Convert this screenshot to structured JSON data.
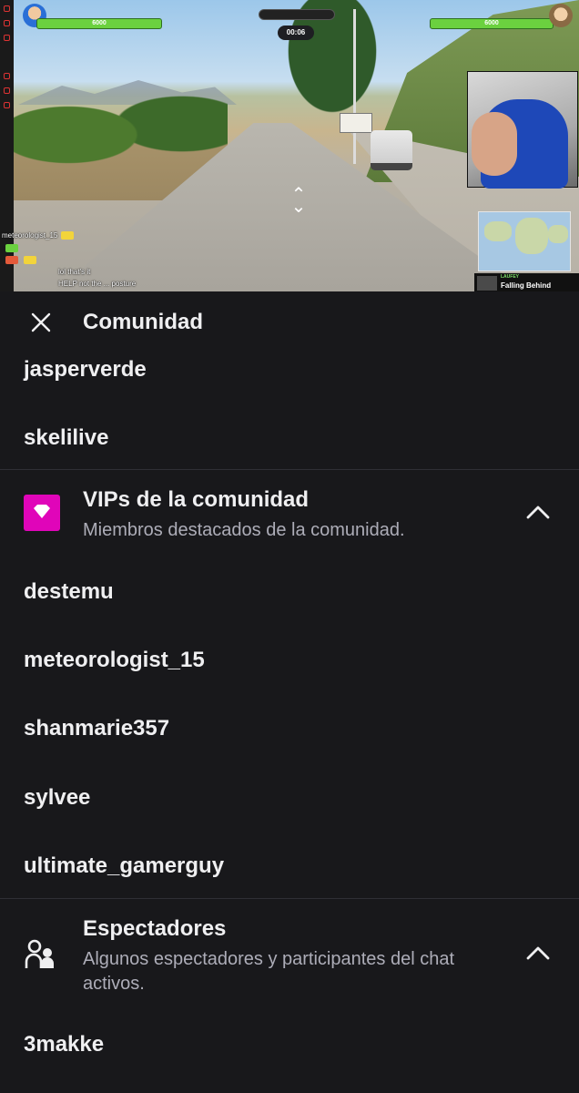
{
  "stream": {
    "hud": {
      "left_score": "6000",
      "right_score": "6000",
      "timer": "00:06",
      "left_name": "",
      "right_name": ""
    },
    "now_playing": {
      "artist": "LAUFEY",
      "song": "Falling Behind"
    },
    "overlay_chat": [
      {
        "user": "meteorologist_15",
        "text": ""
      },
      {
        "user": "",
        "text": ""
      },
      {
        "user": "",
        "text": "lol that's it"
      },
      {
        "user": "",
        "text": "HELP not the ... posture"
      }
    ]
  },
  "panel": {
    "title": "Comunidad",
    "top_users": [
      "jasperverde",
      "skelilive"
    ],
    "vip_section": {
      "title": "VIPs de la comunidad",
      "subtitle": "Miembros destacados de la comunidad.",
      "icon": "diamond-icon",
      "users": [
        "destemu",
        "meteorologist_15",
        "shanmarie357",
        "sylvee",
        "ultimate_gamerguy"
      ]
    },
    "viewers_section": {
      "title": "Espectadores",
      "subtitle": "Algunos espectadores y participantes del chat activos.",
      "icon": "viewers-icon",
      "users": [
        "3makke"
      ]
    }
  },
  "colors": {
    "background": "#18181b",
    "text": "#efeff1",
    "muted": "#adadb8",
    "vip_accent": "#e005b9",
    "divider": "#2f2f35"
  }
}
